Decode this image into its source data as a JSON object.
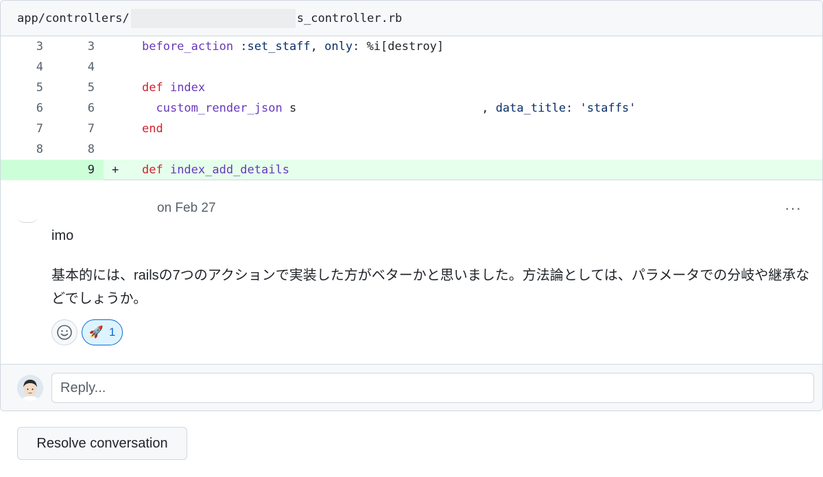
{
  "file_header": {
    "path_prefix": "app/controllers/",
    "path_suffix": "s_controller.rb"
  },
  "diff": {
    "rows": [
      {
        "old": "3",
        "new": "3",
        "marker": "",
        "type": "context"
      },
      {
        "old": "4",
        "new": "4",
        "marker": "",
        "type": "context"
      },
      {
        "old": "5",
        "new": "5",
        "marker": "",
        "type": "context"
      },
      {
        "old": "6",
        "new": "6",
        "marker": "",
        "type": "context"
      },
      {
        "old": "7",
        "new": "7",
        "marker": "",
        "type": "context"
      },
      {
        "old": "8",
        "new": "8",
        "marker": "",
        "type": "context"
      },
      {
        "old": "",
        "new": "9",
        "marker": "+",
        "type": "added"
      }
    ],
    "code": {
      "line3": {
        "method": "before_action",
        "sym": " :set_staff",
        "comma": ", ",
        "only": "only:",
        "rest": " %i[destroy]"
      },
      "line5": {
        "kw": "def",
        "name": " index"
      },
      "line6": {
        "call": "custom_render_json",
        "frag": " s",
        "tail": ", ",
        "key": "data_title:",
        "val": " 'staffs'"
      },
      "line7": {
        "kw": "end"
      },
      "line9": {
        "kw": "def",
        "name": " index_add_details"
      }
    }
  },
  "comment": {
    "date": "on Feb 27",
    "menu": "···",
    "line1": "imo",
    "line2": "基本的には、railsの7つのアクションで実装した方がベターかと思いました。方法論としては、パラメータでの分岐や継承などでしょうか。",
    "reaction_emoji": "🚀",
    "reaction_count": "1"
  },
  "reply": {
    "placeholder": "Reply..."
  },
  "resolve": {
    "label": "Resolve conversation"
  },
  "colors": {
    "added_bg": "#e6ffec",
    "added_gutter": "#ccffd8",
    "keyword": "#cf222e",
    "function": "#6639ba",
    "symbol": "#0a3069",
    "accent": "#0969da"
  }
}
